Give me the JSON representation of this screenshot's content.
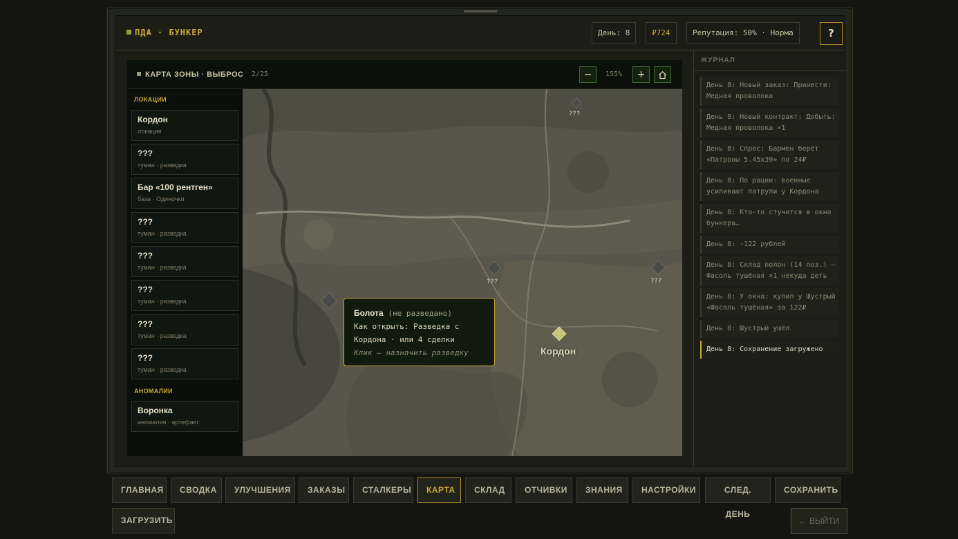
{
  "header": {
    "brand": "ПДА · БУНКЕР",
    "day": "День: 8",
    "money": "₽724",
    "reputation": "Репутация: 50% · Норма",
    "help_label": "?"
  },
  "map_panel": {
    "title": "КАРТА ЗОНЫ · ВЫБРОС",
    "count": "2/25",
    "zoom_out": "−",
    "zoom_level": "155%",
    "zoom_in": "+",
    "home_icon": "home-icon"
  },
  "sidebar": {
    "locations_title": "ЛОКАЦИИ",
    "locations": [
      {
        "name": "Кордон",
        "sub": "локация"
      },
      {
        "name": "???",
        "sub": "туман · разведка"
      },
      {
        "name": "Бар «100 рентген»",
        "sub": "база · Одиночки"
      },
      {
        "name": "???",
        "sub": "туман · разведка"
      },
      {
        "name": "???",
        "sub": "туман · разведка"
      },
      {
        "name": "???",
        "sub": "туман · разведка"
      },
      {
        "name": "???",
        "sub": "туман · разведка"
      },
      {
        "name": "???",
        "sub": "туман · разведка"
      }
    ],
    "anomalies_title": "АНОМАЛИИ",
    "anomalies": [
      {
        "name": "Воронка",
        "sub": "аномалия · артефакт"
      }
    ]
  },
  "map": {
    "cordon_label": "Кордон",
    "unknown_label": "???",
    "marker_colors": {
      "known": "#c9c47a",
      "unknown": "#4a4a48"
    }
  },
  "tooltip": {
    "name": "Болота",
    "state": "(не разведано)",
    "line1": "Как открыть: Разведка с",
    "line2": "Кордона · или 4 сделки",
    "hint": "Клик — назначить разведку"
  },
  "journal": {
    "title": "ЖУРНАЛ",
    "entries": [
      "День 8: Новый заказ: Принести: Медная проволока",
      "День 8: Новый контракт: Добыть: Медная проволока ×1",
      "День 8: Спрос: Бармен берёт «Патроны 5.45x39» по 24₽",
      "День 8: По рации: военные усиливают патрули у Кордона",
      "День 8: Кто-то стучится в окно бункера…",
      "День 8: -122 рублей",
      "День 8: Склад полон (14 поз.) — Фасоль тушёная ×1 некуда деть",
      "День 8: У окна: купил у Шустрый «Фасоль тушёная» за 122₽",
      "День 8: Шустрый ушёл",
      "День 8: Сохранение загружено"
    ]
  },
  "tabs": [
    "ГЛАВНАЯ",
    "СВОДКА",
    "УЛУЧШЕНИЯ",
    "ЗАКАЗЫ",
    "СТАЛКЕРЫ",
    "КАРТА",
    "СКЛАД",
    "ОТЧИВКИ",
    "ЗНАНИЯ",
    "НАСТРОЙКИ",
    "СЛЕД. ДЕНЬ",
    "СОХРАНИТЬ",
    "ЗАГРУЗИТЬ"
  ],
  "active_tab": "КАРТА",
  "exit_label": "← ВЫЙТИ"
}
